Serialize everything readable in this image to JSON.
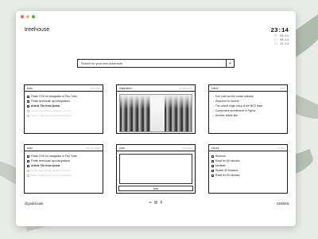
{
  "window": {
    "traffic_colors": [
      "#fe5f57",
      "#febc2e",
      "#28c840"
    ]
  },
  "brand": "treehouse",
  "clock": {
    "time": "23:14",
    "zones": [
      {
        "label": "SF",
        "time": "03:14"
      },
      {
        "label": "NY",
        "time": "06:14"
      },
      {
        "label": "LD",
        "time": "22:14"
      }
    ]
  },
  "search": {
    "placeholder": "Search for your next adventure",
    "button": "+"
  },
  "cards": {
    "todo_top": {
      "title": "todo",
      "tag": "personal",
      "items": [
        {
          "text": "Finish CSS for navigation in Tiny Tools",
          "style": "normal"
        },
        {
          "text": "Finish treehouse api integrations",
          "style": "normal"
        },
        {
          "text": "Article Tile from Arena",
          "style": "bold"
        },
        {
          "text": "Create Assessment details for Arrows",
          "style": "muted"
        },
        {
          "text": "Make a Habit list on Notion wireframes",
          "style": "muted"
        }
      ]
    },
    "inspiration": {
      "title": "inspiration",
      "tag": "architecture"
    },
    "inbox": {
      "title": "inbox",
      "tag": "feed",
      "items": [
        {
          "text": "Don't sell out the cruise industry",
          "style": "normal"
        },
        {
          "text": "Welcome to Income",
          "style": "normal"
        },
        {
          "text": "The untold origin story of the NES reset",
          "style": "normal"
        },
        {
          "text": "Component architecture in Figma",
          "style": "normal"
        },
        {
          "text": "Another article title",
          "style": "normal"
        }
      ]
    },
    "todo_bottom": {
      "title": "todo",
      "tag": "day by dates",
      "items": [
        {
          "text": "Finish CSS for navigation in Tiny Tools",
          "style": "normal"
        },
        {
          "text": "Finish treehouse api integrations",
          "style": "normal"
        },
        {
          "text": "Article Tile from Arena",
          "style": "bold"
        },
        {
          "text": "Create Assessment details for Arrows",
          "style": "muted"
        },
        {
          "text": "Make a Habit list on Notion wireframes",
          "style": "muted"
        }
      ]
    },
    "post": {
      "title": "post",
      "tag": "thoughts",
      "button": "post"
    },
    "hours": {
      "title": "Hours",
      "tag": "today",
      "items": [
        {
          "text": "Workout",
          "style": "normal"
        },
        {
          "text": "Read for 60 minutes",
          "style": "normal"
        },
        {
          "text": "Meditate",
          "style": "normal"
        },
        {
          "text": "Sketch 30 Mosaics",
          "style": "normal"
        },
        {
          "text": "Read for 60 minutes",
          "style": "normal"
        }
      ]
    }
  },
  "footer": {
    "handle": "@gndclouds",
    "version": "v200401",
    "icons": [
      "arena-icon",
      "notion-icon",
      "figma-icon"
    ]
  }
}
